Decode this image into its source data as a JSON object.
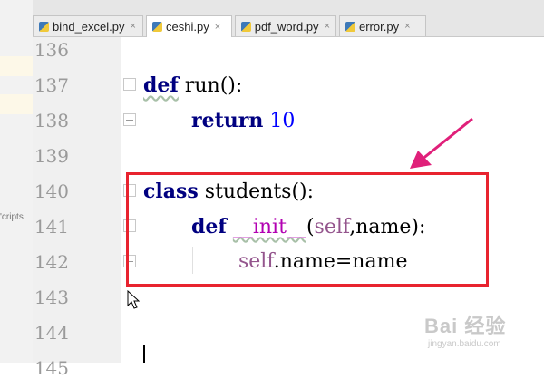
{
  "tabs": [
    {
      "label": "bind_excel.py",
      "active": false
    },
    {
      "label": "ceshi.py",
      "active": true
    },
    {
      "label": "pdf_word.py",
      "active": false
    },
    {
      "label": "error.py",
      "active": false
    }
  ],
  "left_panel_fragment": "cripts'",
  "line_numbers": [
    "136",
    "137",
    "138",
    "139",
    "140",
    "141",
    "142",
    "143",
    "144",
    "145"
  ],
  "code": {
    "l137_kw": "def",
    "l137_rest": " run():",
    "l138_kw": "return",
    "l138_num": "10",
    "l140_kw": "class",
    "l140_rest": " students():",
    "l141_kw": "def",
    "l141_name": "__init__",
    "l141_open": "(",
    "l141_self": "self",
    "l141_rest": ",name):",
    "l142_self": "self",
    "l142_rest": ".name=name"
  },
  "colors": {
    "keyword": "#000080",
    "self": "#94558d",
    "number": "#0000ff",
    "annotation": "#e8232f",
    "arrow": "#e0207a"
  },
  "watermark": {
    "main": "Bai 经验",
    "sub": "jingyan.baidu.com"
  }
}
